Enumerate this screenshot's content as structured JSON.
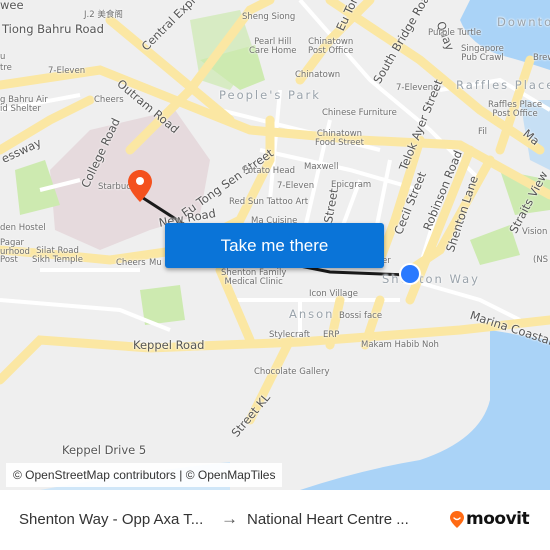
{
  "map": {
    "labels": {
      "tiong_bahru_road": "Tiong Bahru Road",
      "central_expressway": "Central Expressway",
      "outram_road": "Outram Road",
      "eu_tong_sen_top": "Eu Tong",
      "south_bridge_road": "South Bridge Road",
      "quay": "Quay",
      "college_road": "College Road",
      "eu_tong_sen_street": "Eu Tong Sen Street",
      "new_road": "New Road",
      "telok_ayer_street": "Telok Ayer Street",
      "cecil_street": "Cecil Street",
      "robinson_road": "Robinson Road",
      "shenton_lane": "Shenton Lane",
      "straits_view": "Straits View",
      "marina_top": "Ma",
      "keppel_road": "Keppel Road",
      "marina_coastal": "Marina Coastal",
      "street_kl": "Street KL",
      "keppel_drive_5": "Keppel Drive 5",
      "street_partial": "Street",
      "expressway_partial": "essway",
      "wee": "wee"
    },
    "areas": {
      "peoples_park": "People's Park",
      "raffles_place": "Raffles Place",
      "downtown": "Downtown",
      "anson": "Anson",
      "shenton_way": "Shenton Way"
    },
    "pois": {
      "j2": "J.2 美食阁",
      "sheng_siong": "Sheng Siong",
      "pearl_hill": "Pearl Hill\nCare Home",
      "chinatown_po": "Chinatown\nPost Office",
      "purple_turtle": "Purple Turtle",
      "sg_pub_crawl": "Singapore\nPub Crawl",
      "brew": "Brew",
      "seven_eleven_1": "7-Eleven",
      "tb_air": "g Bahru Air\nid Shelter",
      "cheers_1": "Cheers",
      "chinatown": "Chinatown",
      "seven_eleven_2": "7-Eleven",
      "raffles_po": "Raffles Place\nPost Office",
      "chinese_furniture": "Chinese Furniture",
      "fil": "Fil",
      "chinatown_food": "Chinatown\nFood Street",
      "potato_head": "Potato Head",
      "maxwell": "Maxwell",
      "seven_eleven_3": "7-Eleven",
      "epicgram": "Epicgram",
      "red_sun": "Red Sun Tattoo Art",
      "ma_cuisine": "Ma Cuisine",
      "starbucks": "Starbucks",
      "hostel": "den Hostel",
      "pagar": "Pagar\nurhood\nPost",
      "silat": "Silat Road\nSikh Temple",
      "cheers_2": "Cheers",
      "mu": "Mu",
      "shenton_clinic": "Shenton Family\nMedical Clinic",
      "icon_village": "Icon Village",
      "bossi": "Bossi face",
      "stylecraft": "Stylecraft",
      "erp": "ERP",
      "makam": "Makam Habib Noh",
      "chocolate": "Chocolate Gallery",
      "vision": "Vision",
      "ns": "(NS",
      "tre": "tre",
      "u": "u",
      "er": "er"
    },
    "cta_label": "Take me there",
    "attribution": "© OpenStreetMap contributors | © OpenMapTiles"
  },
  "route": {
    "origin": "Shenton Way - Opp Axa T...",
    "destination": "National Heart Centre ...",
    "arrow_icon": "→"
  },
  "brand": {
    "name": "moovit",
    "color": "#ff6a13"
  },
  "colors": {
    "cta": "#0a74d8",
    "origin_dot": "#2979ff",
    "dest_pin": "#f4511e",
    "water": "#aad3f7",
    "road": "#fbe7a3",
    "park": "#cdeab0",
    "hospital": "#e6dadd"
  }
}
